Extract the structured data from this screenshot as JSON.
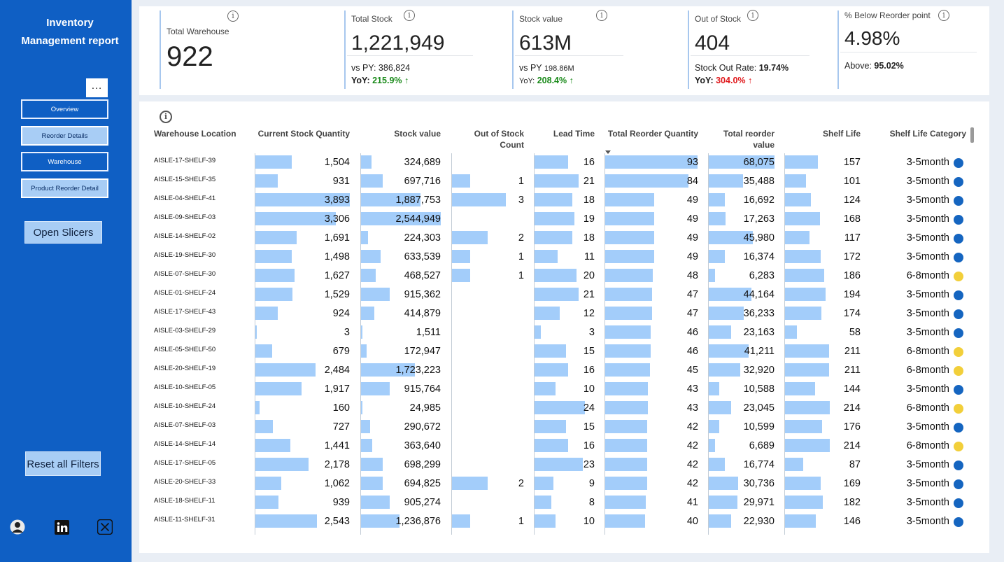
{
  "sidebar": {
    "title_line1": "Inventory",
    "title_line2": "Management report",
    "more_label": "…",
    "nav": [
      {
        "label": "Overview",
        "style": "dark"
      },
      {
        "label": "Reorder Details",
        "style": "light"
      },
      {
        "label": "Warehouse",
        "style": "dark"
      },
      {
        "label": "Product Reorder Detail",
        "style": "light"
      }
    ],
    "open_slicers": "Open Slicers",
    "reset_filters": "Reset all Filters",
    "social_icons": [
      "avatar-icon",
      "linkedin-icon",
      "x-icon"
    ]
  },
  "kpis": {
    "total_warehouse": {
      "label": "Total Warehouse",
      "value": "922"
    },
    "total_stock": {
      "label": "Total Stock",
      "value": "1,221,949",
      "vs_label": "vs PY:",
      "vs_value": "386,824",
      "yoy_label": "YoY:",
      "yoy_value": "215.9%",
      "arrow": "↑"
    },
    "stock_value": {
      "label": "Stock value",
      "value": "613M",
      "vs_label": "vs PY",
      "vs_value": "198.86M",
      "yoy_label": "YoY:",
      "yoy_value": "208.4%",
      "arrow": "↑"
    },
    "out_of_stock": {
      "label": "Out of Stock",
      "value": "404",
      "rate_label": "Stock Out Rate:",
      "rate_value": "19.74%",
      "yoy_label": "YoY:",
      "yoy_value": "304.0%",
      "arrow": "↑"
    },
    "below_reorder": {
      "label": "% Below Reorder point",
      "value": "4.98%",
      "above_label": "Above:",
      "above_value": "95.02%"
    }
  },
  "colors": {
    "bar": "#a3cdfa",
    "cat_3_5": "#1565c0",
    "cat_6_8": "#f2cf3a",
    "sidebar": "#0f5fc4",
    "up_green": "#1a8a1a",
    "up_red": "#e0191c"
  },
  "table": {
    "headers": {
      "location": "Warehouse Location",
      "qty": "Current Stock Quantity",
      "value": "Stock value",
      "oos_1": "Out of Stock",
      "oos_2": "Count",
      "lead": "Lead Time",
      "reorder_qty": "Total Reorder Quantity",
      "reorder_val_1": "Total reorder",
      "reorder_val_2": "value",
      "shelf": "Shelf Life",
      "category": "Shelf Life Category"
    },
    "rows": [
      {
        "loc": "AISLE-17-SHELF-39",
        "qty": "1,504",
        "qty_n": 1504,
        "val": "324,689",
        "val_n": 324689,
        "oos": "",
        "oos_n": 0,
        "lead": "16",
        "lead_n": 16,
        "rq": "93",
        "rq_n": 93,
        "rv": "68,075",
        "rv_n": 68075,
        "sl": "157",
        "sl_n": 157,
        "cat": "3-5month"
      },
      {
        "loc": "AISLE-15-SHELF-35",
        "qty": "931",
        "qty_n": 931,
        "val": "697,716",
        "val_n": 697716,
        "oos": "1",
        "oos_n": 1,
        "lead": "21",
        "lead_n": 21,
        "rq": "84",
        "rq_n": 84,
        "rv": "35,488",
        "rv_n": 35488,
        "sl": "101",
        "sl_n": 101,
        "cat": "3-5month"
      },
      {
        "loc": "AISLE-04-SHELF-41",
        "qty": "3,893",
        "qty_n": 3893,
        "val": "1,887,753",
        "val_n": 1887753,
        "oos": "3",
        "oos_n": 3,
        "lead": "18",
        "lead_n": 18,
        "rq": "49",
        "rq_n": 49,
        "rv": "16,692",
        "rv_n": 16692,
        "sl": "124",
        "sl_n": 124,
        "cat": "3-5month"
      },
      {
        "loc": "AISLE-09-SHELF-03",
        "qty": "3,306",
        "qty_n": 3306,
        "val": "2,544,949",
        "val_n": 2544949,
        "oos": "",
        "oos_n": 0,
        "lead": "19",
        "lead_n": 19,
        "rq": "49",
        "rq_n": 49,
        "rv": "17,263",
        "rv_n": 17263,
        "sl": "168",
        "sl_n": 168,
        "cat": "3-5month"
      },
      {
        "loc": "AISLE-14-SHELF-02",
        "qty": "1,691",
        "qty_n": 1691,
        "val": "224,303",
        "val_n": 224303,
        "oos": "2",
        "oos_n": 2,
        "lead": "18",
        "lead_n": 18,
        "rq": "49",
        "rq_n": 49,
        "rv": "45,980",
        "rv_n": 45980,
        "sl": "117",
        "sl_n": 117,
        "cat": "3-5month"
      },
      {
        "loc": "AISLE-19-SHELF-30",
        "qty": "1,498",
        "qty_n": 1498,
        "val": "633,539",
        "val_n": 633539,
        "oos": "1",
        "oos_n": 1,
        "lead": "11",
        "lead_n": 11,
        "rq": "49",
        "rq_n": 49,
        "rv": "16,374",
        "rv_n": 16374,
        "sl": "172",
        "sl_n": 172,
        "cat": "3-5month"
      },
      {
        "loc": "AISLE-07-SHELF-30",
        "qty": "1,627",
        "qty_n": 1627,
        "val": "468,527",
        "val_n": 468527,
        "oos": "1",
        "oos_n": 1,
        "lead": "20",
        "lead_n": 20,
        "rq": "48",
        "rq_n": 48,
        "rv": "6,283",
        "rv_n": 6283,
        "sl": "186",
        "sl_n": 186,
        "cat": "6-8month"
      },
      {
        "loc": "AISLE-01-SHELF-24",
        "qty": "1,529",
        "qty_n": 1529,
        "val": "915,362",
        "val_n": 915362,
        "oos": "",
        "oos_n": 0,
        "lead": "21",
        "lead_n": 21,
        "rq": "47",
        "rq_n": 47,
        "rv": "44,164",
        "rv_n": 44164,
        "sl": "194",
        "sl_n": 194,
        "cat": "3-5month"
      },
      {
        "loc": "AISLE-17-SHELF-43",
        "qty": "924",
        "qty_n": 924,
        "val": "414,879",
        "val_n": 414879,
        "oos": "",
        "oos_n": 0,
        "lead": "12",
        "lead_n": 12,
        "rq": "47",
        "rq_n": 47,
        "rv": "36,233",
        "rv_n": 36233,
        "sl": "174",
        "sl_n": 174,
        "cat": "3-5month"
      },
      {
        "loc": "AISLE-03-SHELF-29",
        "qty": "3",
        "qty_n": 3,
        "val": "1,511",
        "val_n": 1511,
        "oos": "",
        "oos_n": 0,
        "lead": "3",
        "lead_n": 3,
        "rq": "46",
        "rq_n": 46,
        "rv": "23,163",
        "rv_n": 23163,
        "sl": "58",
        "sl_n": 58,
        "cat": "3-5month"
      },
      {
        "loc": "AISLE-05-SHELF-50",
        "qty": "679",
        "qty_n": 679,
        "val": "172,947",
        "val_n": 172947,
        "oos": "",
        "oos_n": 0,
        "lead": "15",
        "lead_n": 15,
        "rq": "46",
        "rq_n": 46,
        "rv": "41,211",
        "rv_n": 41211,
        "sl": "211",
        "sl_n": 211,
        "cat": "6-8month"
      },
      {
        "loc": "AISLE-20-SHELF-19",
        "qty": "2,484",
        "qty_n": 2484,
        "val": "1,723,223",
        "val_n": 1723223,
        "oos": "",
        "oos_n": 0,
        "lead": "16",
        "lead_n": 16,
        "rq": "45",
        "rq_n": 45,
        "rv": "32,920",
        "rv_n": 32920,
        "sl": "211",
        "sl_n": 211,
        "cat": "6-8month"
      },
      {
        "loc": "AISLE-10-SHELF-05",
        "qty": "1,917",
        "qty_n": 1917,
        "val": "915,764",
        "val_n": 915764,
        "oos": "",
        "oos_n": 0,
        "lead": "10",
        "lead_n": 10,
        "rq": "43",
        "rq_n": 43,
        "rv": "10,588",
        "rv_n": 10588,
        "sl": "144",
        "sl_n": 144,
        "cat": "3-5month"
      },
      {
        "loc": "AISLE-10-SHELF-24",
        "qty": "160",
        "qty_n": 160,
        "val": "24,985",
        "val_n": 24985,
        "oos": "",
        "oos_n": 0,
        "lead": "24",
        "lead_n": 24,
        "rq": "43",
        "rq_n": 43,
        "rv": "23,045",
        "rv_n": 23045,
        "sl": "214",
        "sl_n": 214,
        "cat": "6-8month"
      },
      {
        "loc": "AISLE-07-SHELF-03",
        "qty": "727",
        "qty_n": 727,
        "val": "290,672",
        "val_n": 290672,
        "oos": "",
        "oos_n": 0,
        "lead": "15",
        "lead_n": 15,
        "rq": "42",
        "rq_n": 42,
        "rv": "10,599",
        "rv_n": 10599,
        "sl": "176",
        "sl_n": 176,
        "cat": "3-5month"
      },
      {
        "loc": "AISLE-14-SHELF-14",
        "qty": "1,441",
        "qty_n": 1441,
        "val": "363,640",
        "val_n": 363640,
        "oos": "",
        "oos_n": 0,
        "lead": "16",
        "lead_n": 16,
        "rq": "42",
        "rq_n": 42,
        "rv": "6,689",
        "rv_n": 6689,
        "sl": "214",
        "sl_n": 214,
        "cat": "6-8month"
      },
      {
        "loc": "AISLE-17-SHELF-05",
        "qty": "2,178",
        "qty_n": 2178,
        "val": "698,299",
        "val_n": 698299,
        "oos": "",
        "oos_n": 0,
        "lead": "23",
        "lead_n": 23,
        "rq": "42",
        "rq_n": 42,
        "rv": "16,774",
        "rv_n": 16774,
        "sl": "87",
        "sl_n": 87,
        "cat": "3-5month"
      },
      {
        "loc": "AISLE-20-SHELF-33",
        "qty": "1,062",
        "qty_n": 1062,
        "val": "694,825",
        "val_n": 694825,
        "oos": "2",
        "oos_n": 2,
        "lead": "9",
        "lead_n": 9,
        "rq": "42",
        "rq_n": 42,
        "rv": "30,736",
        "rv_n": 30736,
        "sl": "169",
        "sl_n": 169,
        "cat": "3-5month"
      },
      {
        "loc": "AISLE-18-SHELF-11",
        "qty": "939",
        "qty_n": 939,
        "val": "905,274",
        "val_n": 905274,
        "oos": "",
        "oos_n": 0,
        "lead": "8",
        "lead_n": 8,
        "rq": "41",
        "rq_n": 41,
        "rv": "29,971",
        "rv_n": 29971,
        "sl": "182",
        "sl_n": 182,
        "cat": "3-5month"
      },
      {
        "loc": "AISLE-11-SHELF-31",
        "qty": "2,543",
        "qty_n": 2543,
        "val": "1,236,876",
        "val_n": 1236876,
        "oos": "1",
        "oos_n": 1,
        "lead": "10",
        "lead_n": 10,
        "rq": "40",
        "rq_n": 40,
        "rv": "22,930",
        "rv_n": 22930,
        "sl": "146",
        "sl_n": 146,
        "cat": "3-5month"
      }
    ]
  }
}
